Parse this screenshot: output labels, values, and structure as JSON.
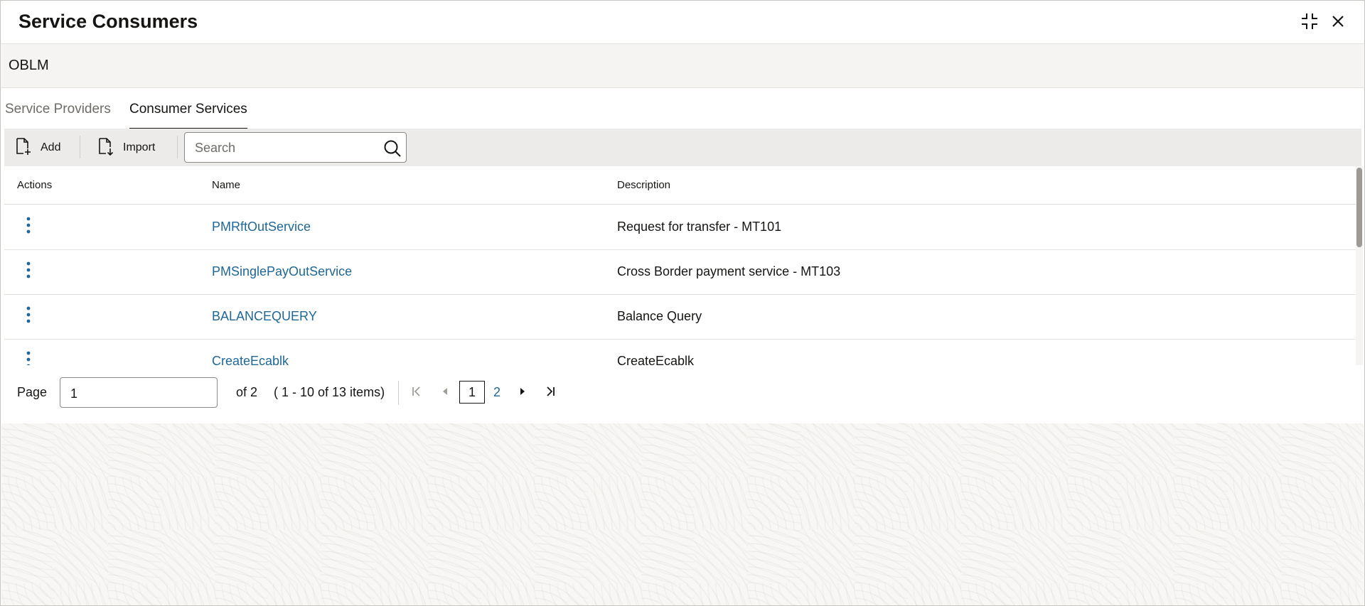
{
  "window": {
    "title": "Service Consumers",
    "context_label": "OBLM"
  },
  "tabs": [
    {
      "label": "Service Providers",
      "active": false
    },
    {
      "label": "Consumer Services",
      "active": true
    }
  ],
  "toolbar": {
    "add_label": "Add",
    "import_label": "Import",
    "search_placeholder": "Search",
    "search_value": ""
  },
  "table": {
    "columns": [
      "Actions",
      "Name",
      "Description"
    ],
    "rows": [
      {
        "name": "PMRftOutService",
        "description": "Request for transfer - MT101"
      },
      {
        "name": "PMSinglePayOutService",
        "description": "Cross Border payment service - MT103"
      },
      {
        "name": "BALANCEQUERY",
        "description": "Balance Query"
      },
      {
        "name": "CreateEcablk",
        "description": "CreateEcablk"
      }
    ]
  },
  "pagination": {
    "page_label": "Page",
    "current_page_value": "1",
    "of_label": "of 2",
    "items_summary": "( 1 - 10 of 13 items)",
    "pages": [
      "1",
      "2"
    ],
    "current_page": "1"
  },
  "icons": {
    "add": "add-document-icon",
    "import": "import-document-icon",
    "search": "search-icon",
    "collapse": "collapse-icon",
    "close": "close-icon",
    "row_actions": "kebab-menu-icon",
    "first": "first-page-icon",
    "prev": "previous-page-icon",
    "next": "next-page-icon",
    "last": "last-page-icon"
  },
  "colors": {
    "link": "#1f6796",
    "accent_underline": "#161513",
    "toolbar_bg": "#ecebe9",
    "context_bg": "#f5f4f2"
  }
}
